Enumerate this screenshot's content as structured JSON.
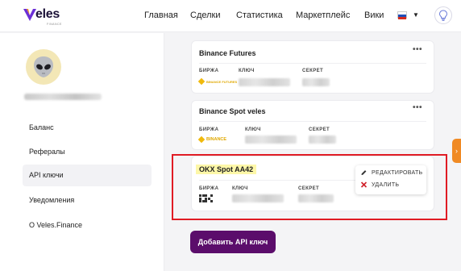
{
  "header": {
    "logo_text": "eles",
    "logo_sub": "FINANCE",
    "nav": [
      "Главная",
      "Сделки",
      "Статистика",
      "Маркетплейс",
      "Вики"
    ],
    "lang_flag": "ru-flag",
    "caret": "▼",
    "bulb_icon": "lightbulb-icon"
  },
  "sidebar": {
    "avatar_icon": "alien-icon",
    "items": [
      {
        "label": "Баланс",
        "active": false
      },
      {
        "label": "Рефералы",
        "active": false
      },
      {
        "label": "API ключи",
        "active": true
      },
      {
        "label": "Уведомления",
        "active": false
      },
      {
        "label": "O Veles.Finance",
        "active": false
      }
    ]
  },
  "columns": {
    "exchange": "БИРЖА",
    "key": "КЛЮЧ",
    "secret": "СЕКРЕТ"
  },
  "cards": [
    {
      "title": "Binance Futures",
      "exchange_logo": "BINANCE FUTURES",
      "menu": "•••"
    },
    {
      "title": "Binance Spot veles",
      "exchange_logo": "BINANCE",
      "menu": "•••"
    },
    {
      "title": "OKX Spot AA42",
      "exchange_logo": "OKX",
      "menu": ""
    }
  ],
  "context_menu": {
    "edit_label": "РЕДАКТИРОВАТЬ",
    "delete_label": "УДАЛИТЬ"
  },
  "add_button_label": "Добавить API ключ",
  "side_tab_glyph": "›",
  "colors": {
    "brand_purple": "#5b0d6b",
    "highlight_yellow": "#fdf7a8",
    "annotation_red": "#e01b24",
    "binance_gold": "#f0b90b",
    "side_tab_orange": "#f08a24"
  }
}
